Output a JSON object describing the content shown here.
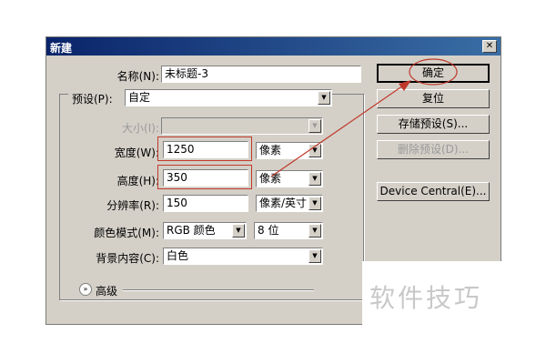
{
  "dialog": {
    "title": "新建",
    "close_glyph": "✕"
  },
  "form": {
    "name_label": "名称(N):",
    "name_value": "未标题-3",
    "preset_label": "预设(P):",
    "preset_value": "自定",
    "size_label": "大小(I):",
    "size_value": "",
    "width_label": "宽度(W):",
    "width_value": "1250",
    "width_unit": "像素",
    "height_label": "高度(H):",
    "height_value": "350",
    "height_unit": "像素",
    "resolution_label": "分辨率(R):",
    "resolution_value": "150",
    "resolution_unit": "像素/英寸",
    "color_mode_label": "颜色模式(M):",
    "color_mode_value": "RGB 颜色",
    "bit_depth_value": "8 位",
    "background_label": "背景内容(C):",
    "background_value": "白色",
    "advanced_label": "高级",
    "advanced_icon_glyph": "»",
    "dropdown_arrow_glyph": "▼"
  },
  "buttons": {
    "ok": "确定",
    "reset": "复位",
    "save_preset": "存储预设(S)...",
    "delete_preset": "删除预设(D)...",
    "device_central": "Device Central(E)..."
  },
  "watermark": {
    "text": "软件技巧"
  },
  "colors": {
    "annotation_red": "#c0392b",
    "title_bar": "#0a246a",
    "dialog_bg": "#d4d0c8"
  }
}
